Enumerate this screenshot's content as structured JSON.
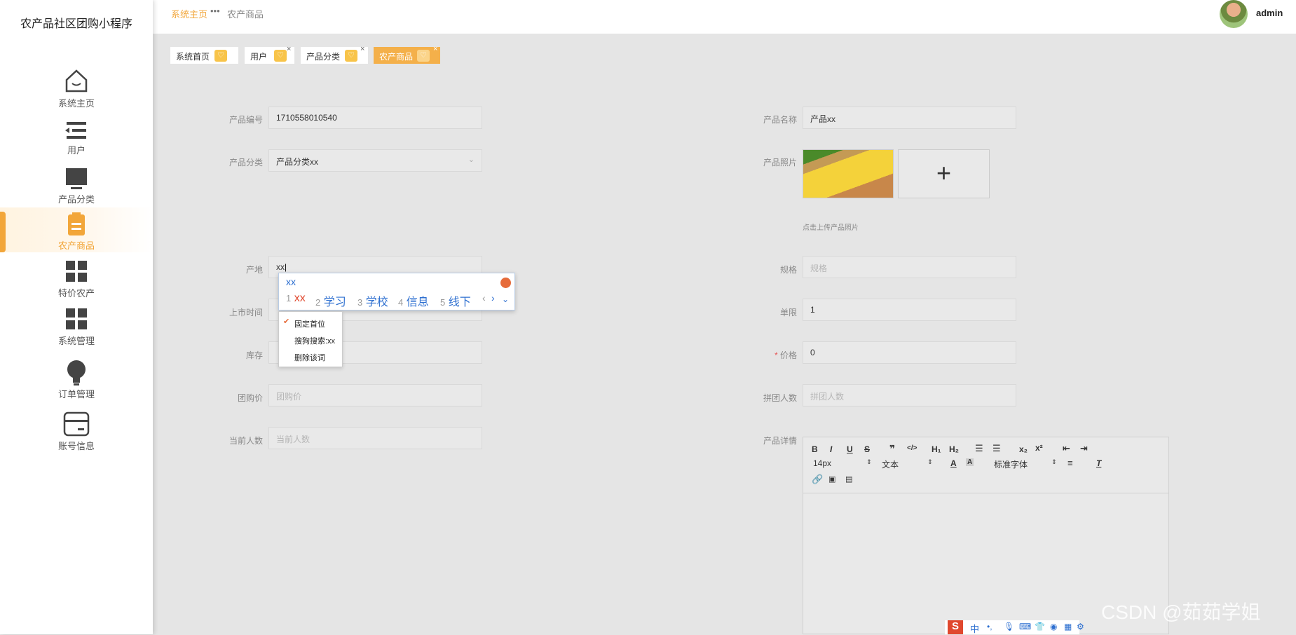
{
  "app": {
    "title": "农产品社区团购小程序"
  },
  "sidebar": {
    "items": [
      {
        "label": "系统主页",
        "icon": "home-icon"
      },
      {
        "label": "用户",
        "icon": "list-icon"
      },
      {
        "label": "产品分类",
        "icon": "monitor-icon"
      },
      {
        "label": "农产商品",
        "icon": "clipboard-icon"
      },
      {
        "label": "特价农产",
        "icon": "grid-icon"
      },
      {
        "label": "系统管理",
        "icon": "grid-icon"
      },
      {
        "label": "订单管理",
        "icon": "bulb-icon"
      },
      {
        "label": "账号信息",
        "icon": "card-icon"
      }
    ],
    "active": "农产商品"
  },
  "header": {
    "breadcrumb": {
      "home": "系统主页",
      "separator": "•••",
      "current": "农产商品"
    },
    "user": "admin"
  },
  "tabs": [
    {
      "label": "系统首页"
    },
    {
      "label": "用户"
    },
    {
      "label": "产品分类"
    },
    {
      "label": "农产商品"
    }
  ],
  "form": {
    "product_no": {
      "label": "产品编号",
      "value": "1710558010540"
    },
    "product_name": {
      "label": "产品名称",
      "value": "产品xx"
    },
    "category": {
      "label": "产品分类",
      "value": "产品分类xx"
    },
    "photo": {
      "label": "产品照片",
      "hint": "点击上传产品照片"
    },
    "origin": {
      "label": "产地",
      "value": "xx"
    },
    "spec": {
      "label": "规格",
      "placeholder": "规格"
    },
    "launch_time": {
      "label": "上市时间"
    },
    "limit": {
      "label": "单限",
      "value": "1"
    },
    "stock": {
      "label": "库存"
    },
    "price": {
      "label": "价格",
      "required": "*",
      "value": "0"
    },
    "group_price": {
      "label": "团购价",
      "placeholder": "团购价"
    },
    "group_size": {
      "label": "拼团人数",
      "placeholder": "拼团人数"
    },
    "current_count": {
      "label": "当前人数",
      "placeholder": "当前人数"
    },
    "details": {
      "label": "产品详情"
    }
  },
  "editor": {
    "font_size": "14px",
    "text_type": "文本",
    "font_family": "标准字体"
  },
  "ime": {
    "input": "xx",
    "candidates": [
      {
        "num": "1",
        "text": "xx"
      },
      {
        "num": "2",
        "text": "学习"
      },
      {
        "num": "3",
        "text": "学校"
      },
      {
        "num": "4",
        "text": "信息"
      },
      {
        "num": "5",
        "text": "线下"
      }
    ],
    "menu": [
      "固定首位",
      "搜狗搜索:xx",
      "删除该词"
    ],
    "ime_mode": "中"
  },
  "watermark": "CSDN @茹茹学姐"
}
